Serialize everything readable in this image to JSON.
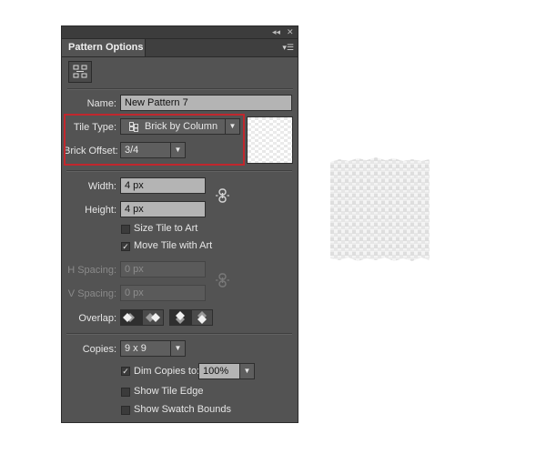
{
  "panel": {
    "title": "Pattern Options",
    "collapse_icon": "double-left-arrow-icon",
    "close_icon": "close-icon",
    "menu_icon": "panel-menu-icon",
    "tile_edit_icon": "pattern-tile-tool-icon"
  },
  "fields": {
    "name_label": "Name:",
    "name_value": "New Pattern 7",
    "tile_type_label": "Tile Type:",
    "tile_type_value": "Brick by Column",
    "brick_offset_label": "Brick Offset:",
    "brick_offset_value": "3/4",
    "width_label": "Width:",
    "width_value": "4 px",
    "height_label": "Height:",
    "height_value": "4 px",
    "size_tile_to_art": "Size Tile to Art",
    "size_tile_to_art_checked": false,
    "move_tile_with_art": "Move Tile with Art",
    "move_tile_with_art_checked": true,
    "h_spacing_label": "H Spacing:",
    "h_spacing_value": "0 px",
    "v_spacing_label": "V Spacing:",
    "v_spacing_value": "0 px",
    "overlap_label": "Overlap:",
    "copies_label": "Copies:",
    "copies_value": "9 x 9",
    "dim_copies_label": "Dim Copies to:",
    "dim_copies_checked": true,
    "dim_copies_value": "100%",
    "show_tile_edge": "Show Tile Edge",
    "show_tile_edge_checked": false,
    "show_swatch_bounds": "Show Swatch Bounds",
    "show_swatch_bounds_checked": false
  },
  "colors": {
    "panel_bg": "#535353",
    "highlight": "#c1272d"
  }
}
